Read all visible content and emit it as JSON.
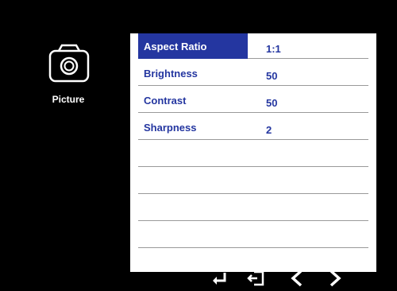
{
  "side": {
    "label": "Picture",
    "icon": "camera-icon"
  },
  "menu": {
    "rows": [
      {
        "label": "Aspect Ratio",
        "value": "1:1",
        "selected": true
      },
      {
        "label": "Brightness",
        "value": "50"
      },
      {
        "label": "Contrast",
        "value": "50"
      },
      {
        "label": "Sharpness",
        "value": "2"
      },
      {
        "label": "",
        "value": ""
      },
      {
        "label": "",
        "value": ""
      },
      {
        "label": "",
        "value": ""
      },
      {
        "label": "",
        "value": ""
      }
    ]
  },
  "footer": {
    "icons": [
      "enter-icon",
      "exit-icon",
      "chevron-left-icon",
      "chevron-right-icon"
    ]
  },
  "colors": {
    "accent": "#2436a0",
    "background": "#000000",
    "panel": "#ffffff"
  }
}
